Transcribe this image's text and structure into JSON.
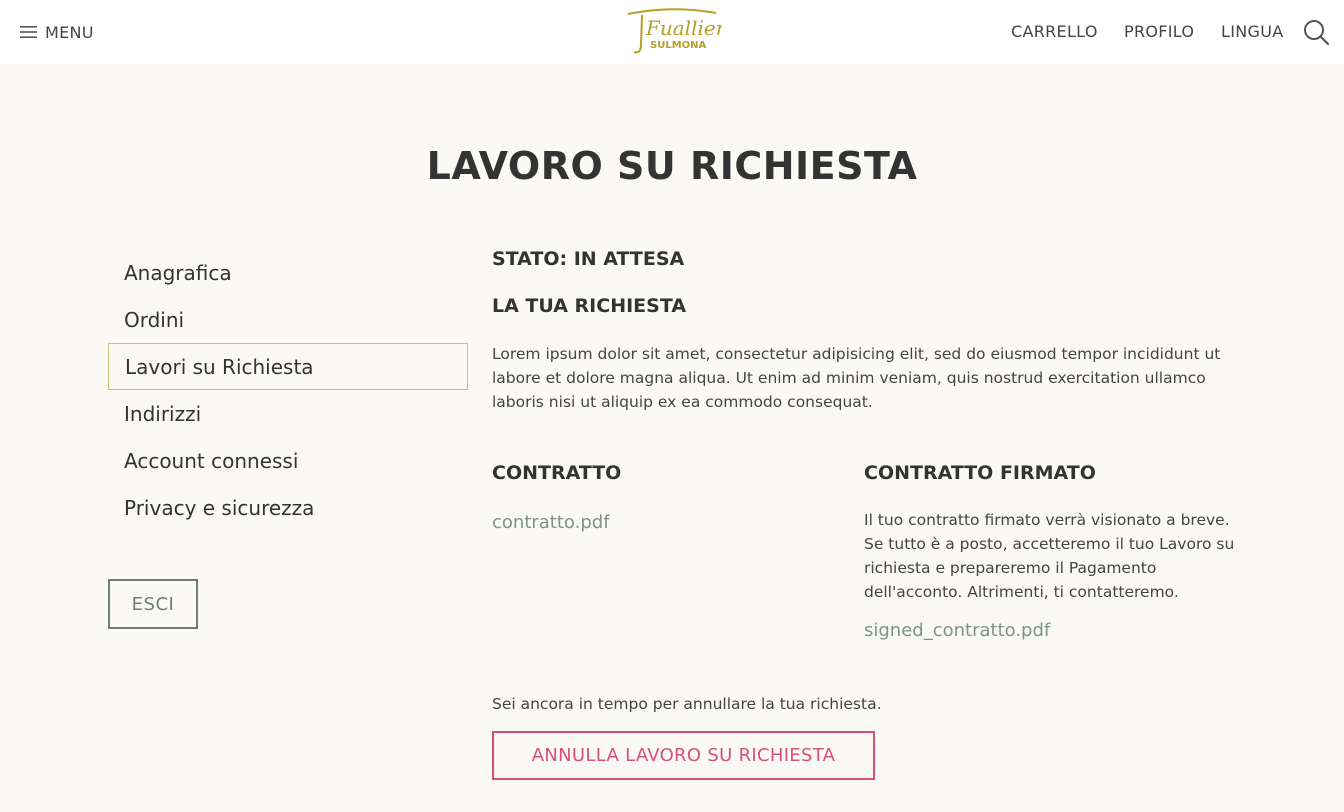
{
  "header": {
    "menu_label": "MENU",
    "brand_name": "Fuallieri",
    "brand_city": "SULMONA",
    "nav": {
      "cart": "CARRELLO",
      "profile": "PROFILO",
      "language": "LINGUA"
    },
    "icons": {
      "menu": "hamburger-icon",
      "search": "search-icon"
    }
  },
  "page_title": "LAVORO SU RICHIESTA",
  "sidebar": {
    "items": [
      {
        "label": "Anagrafica",
        "active": false
      },
      {
        "label": "Ordini",
        "active": false
      },
      {
        "label": "Lavori su Richiesta",
        "active": true
      },
      {
        "label": "Indirizzi",
        "active": false
      },
      {
        "label": "Account connessi",
        "active": false
      },
      {
        "label": "Privacy e sicurezza",
        "active": false
      }
    ],
    "logout_label": "ESCI"
  },
  "content": {
    "status": "STATO: IN ATTESA",
    "request_heading": "LA TUA RICHIESTA",
    "request_text": "Lorem ipsum dolor sit amet, consectetur adipisicing elit, sed do eiusmod tempor incididunt ut labore et dolore magna aliqua. Ut enim ad minim veniam, quis nostrud exercitation ullamco laboris nisi ut aliquip ex ea commodo consequat.",
    "contract_heading": "CONTRATTO",
    "contract_file": "contratto.pdf",
    "signed_heading": "CONTRATTO FIRMATO",
    "signed_text": "Il tuo contratto firmato verrà visionato a breve. Se tutto è a posto, accetteremo il tuo Lavoro su richiesta e prepareremo il Pagamento dell'acconto. Altrimenti, ti contatteremo.",
    "signed_file": "signed_contratto.pdf",
    "cancel_note": "Sei ancora in tempo per annullare la tua richiesta.",
    "cancel_button": "ANNULLA LAVORO SU RICHIESTA"
  },
  "colors": {
    "background": "#faf9f4",
    "header_bg": "#ffffff",
    "brand_gold": "#b5a02a",
    "link_green": "#7e9586",
    "logout_border": "#6c7f72",
    "active_border": "#c9c07a",
    "danger_pink": "#d94f7c"
  }
}
